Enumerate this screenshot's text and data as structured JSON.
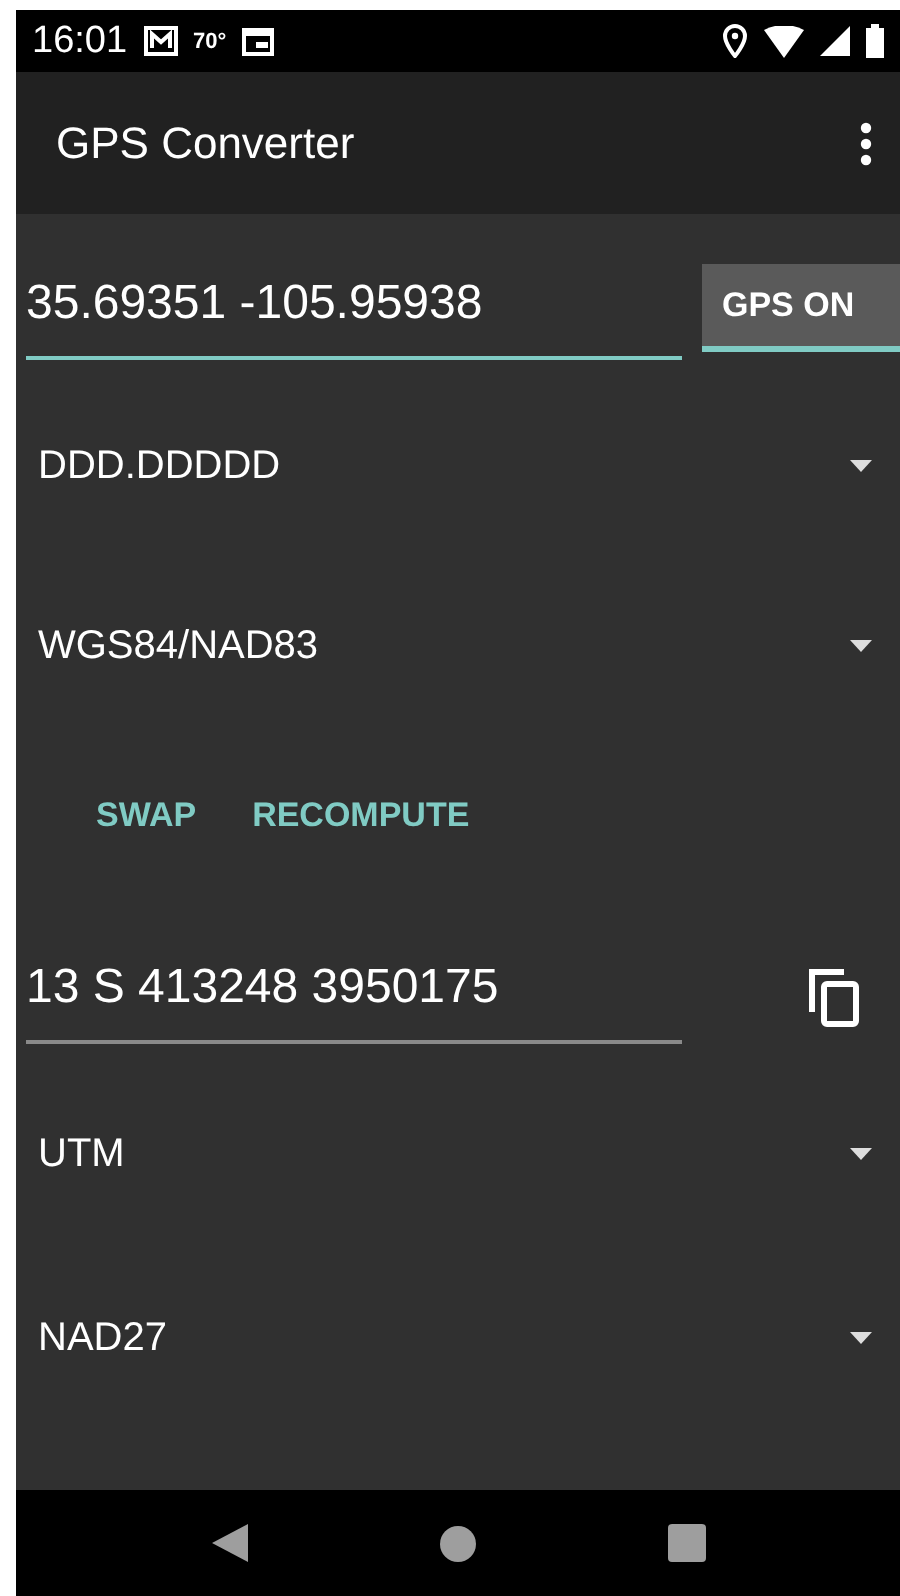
{
  "status_bar": {
    "time": "16:01",
    "temperature": "70°"
  },
  "app_bar": {
    "title": "GPS Converter"
  },
  "input": {
    "value": "35.69351 -105.95938",
    "focused": true
  },
  "gps_toggle": {
    "label": "GPS ON",
    "on": true
  },
  "input_format": {
    "value": "DDD.DDDDD"
  },
  "input_datum": {
    "value": "WGS84/NAD83"
  },
  "actions": [
    "SWAP",
    "RECOMPUTE"
  ],
  "output": {
    "value": "13 S 413248 3950175",
    "focused": false
  },
  "output_format": {
    "value": "UTM"
  },
  "output_datum": {
    "value": "NAD27"
  }
}
